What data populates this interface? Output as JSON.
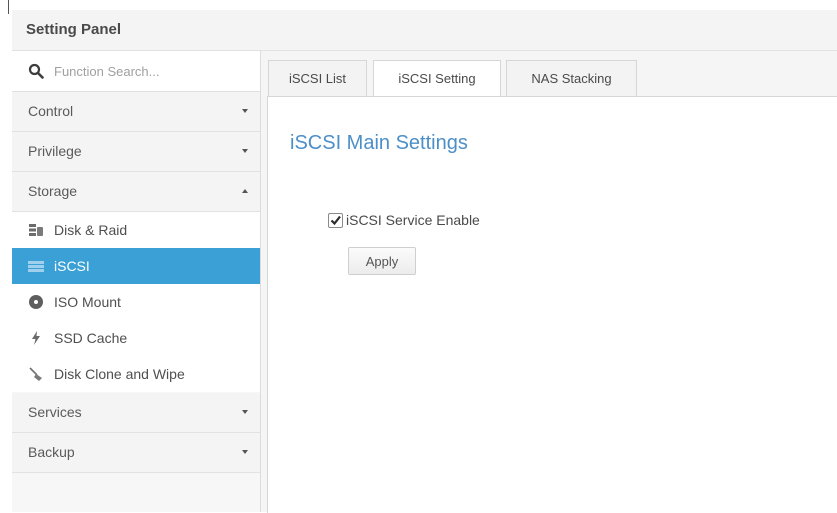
{
  "window": {
    "title": "Setting Panel"
  },
  "sidebar": {
    "search": {
      "placeholder": "Function Search...",
      "value": ""
    },
    "groups": [
      {
        "label": "Control",
        "expanded": false
      },
      {
        "label": "Privilege",
        "expanded": false
      },
      {
        "label": "Storage",
        "expanded": true
      },
      {
        "label": "Services",
        "expanded": false
      },
      {
        "label": "Backup",
        "expanded": false
      }
    ],
    "storage_items": [
      {
        "label": "Disk & Raid",
        "icon": "disk-raid-icon"
      },
      {
        "label": "iSCSI",
        "icon": "iscsi-icon",
        "active": true
      },
      {
        "label": "ISO Mount",
        "icon": "iso-mount-icon"
      },
      {
        "label": "SSD Cache",
        "icon": "lightning-icon"
      },
      {
        "label": "Disk Clone and Wipe",
        "icon": "broom-icon"
      }
    ]
  },
  "tabs": [
    {
      "label": "iSCSI List",
      "active": false
    },
    {
      "label": "iSCSI Setting",
      "active": true
    },
    {
      "label": "NAS Stacking",
      "active": false
    }
  ],
  "content": {
    "section_title": "iSCSI Main Settings",
    "service_enable_label": "iSCSI Service Enable",
    "service_enabled": true,
    "apply_label": "Apply"
  },
  "colors": {
    "active_item_bg": "#3aa0d6",
    "section_title": "#4c8fc8"
  }
}
